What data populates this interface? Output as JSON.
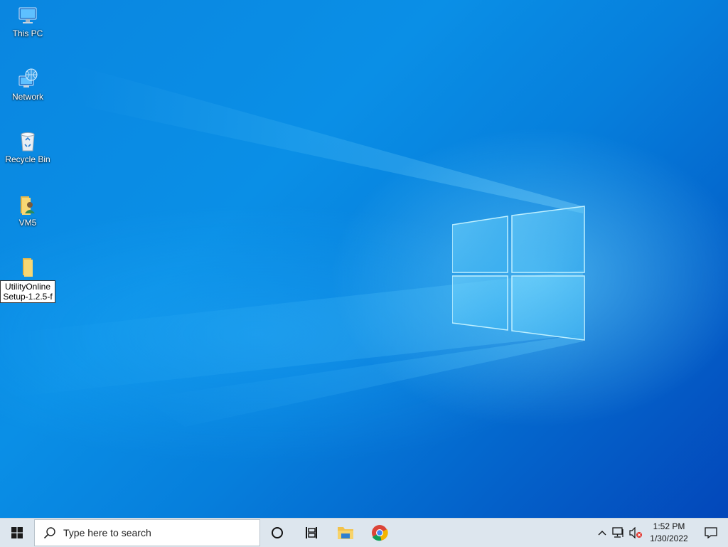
{
  "desktop": {
    "icons": [
      {
        "label": "This PC",
        "icon": "this-pc-icon"
      },
      {
        "label": "Network",
        "icon": "network-icon"
      },
      {
        "label": "Recycle Bin",
        "icon": "recycle-bin-icon"
      },
      {
        "label": "VM5",
        "icon": "user-folder-icon"
      },
      {
        "label": "UtilityOnlineSetup-1.2.5-f",
        "icon": "folder-icon",
        "renaming": true
      }
    ]
  },
  "taskbar": {
    "start": "start-icon",
    "search_placeholder": "Type here to search",
    "pinned": [
      "cortana-icon",
      "task-view-icon",
      "file-explorer-icon",
      "chrome-icon"
    ],
    "tray": {
      "time": "1:52 PM",
      "date": "1/30/2022",
      "icons": [
        "chevron-up-icon",
        "network-status-icon",
        "volume-muted-icon",
        "notifications-icon"
      ]
    }
  },
  "colors": {
    "wallpaper_primary": "#0a86e0",
    "taskbar_bg": "#dde6ee"
  }
}
